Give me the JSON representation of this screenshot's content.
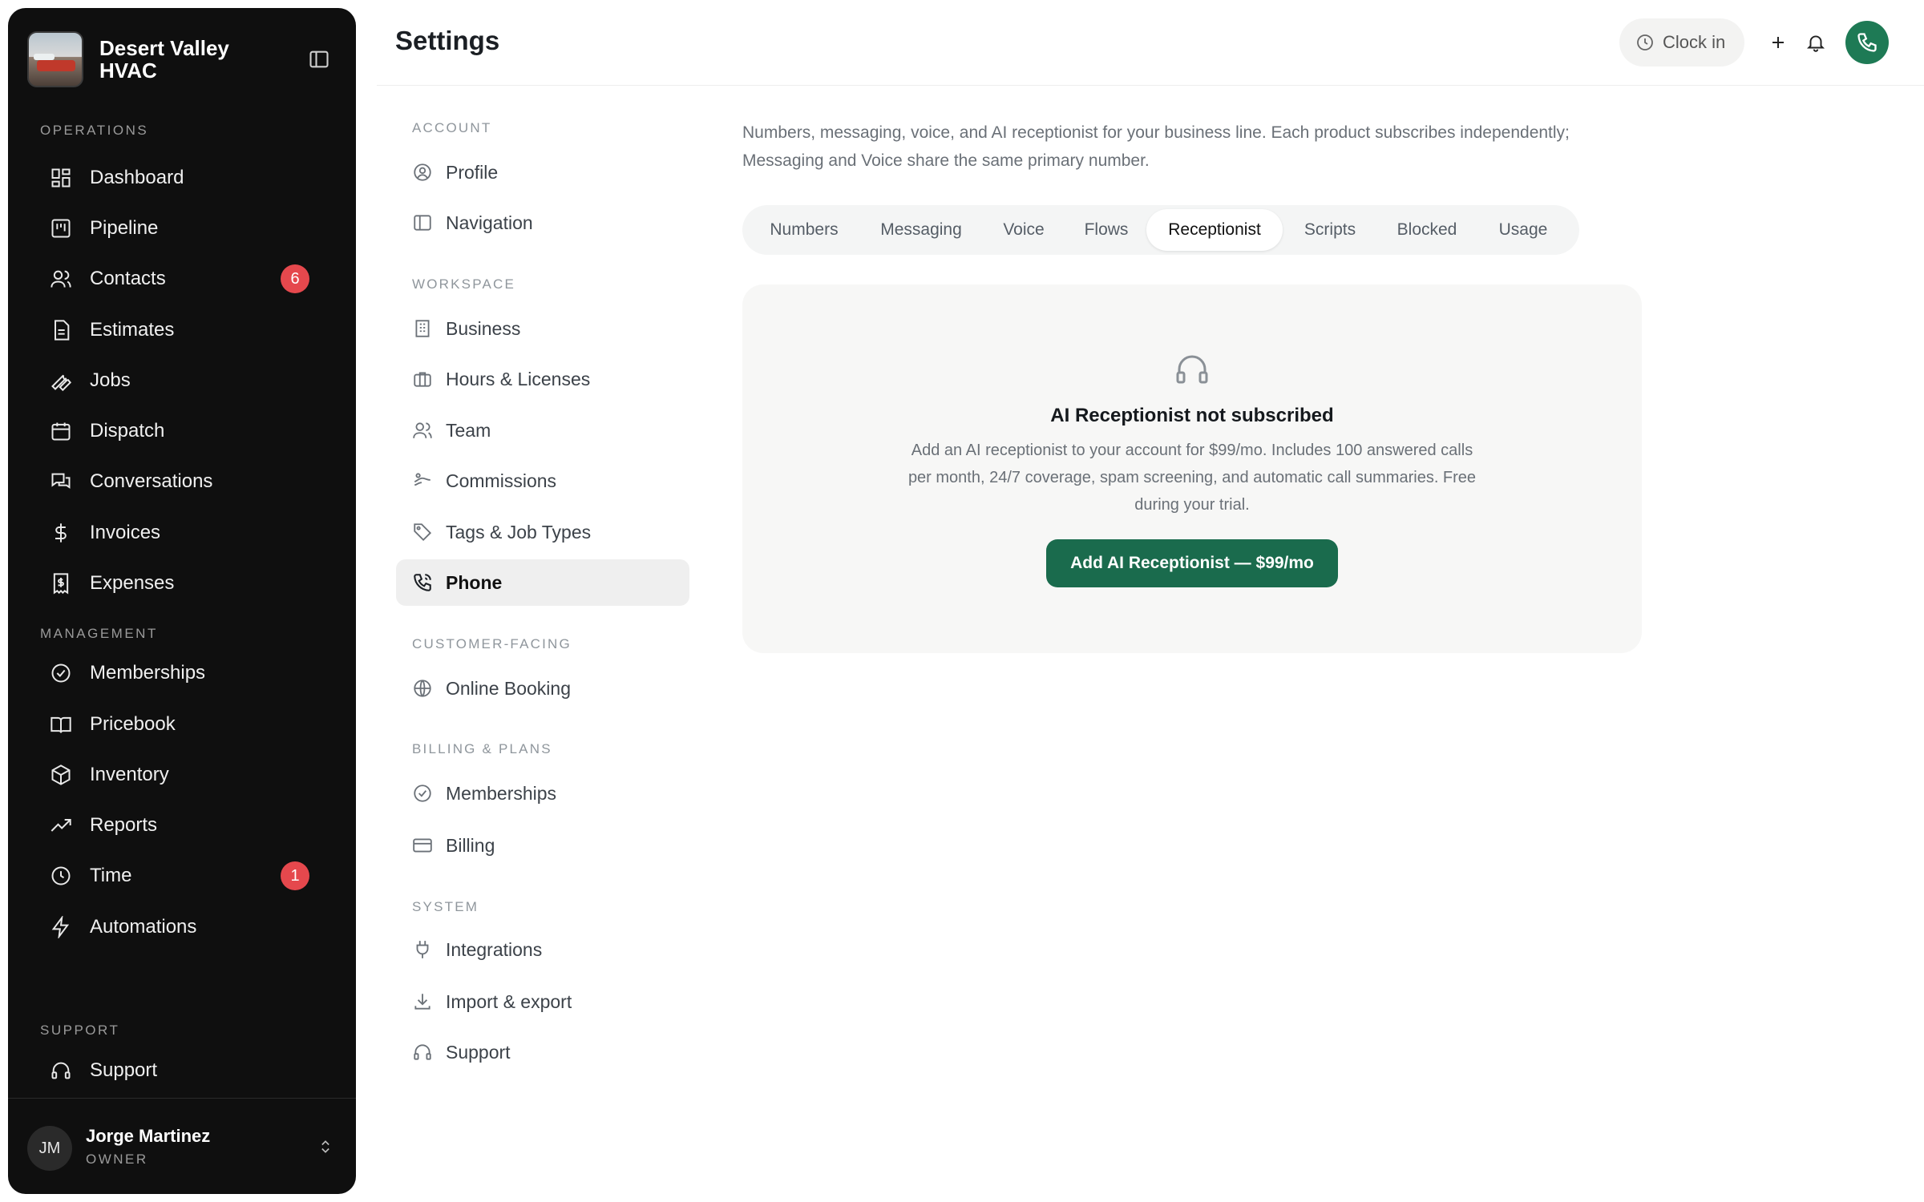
{
  "brand": {
    "name": "Desert Valley HVAC"
  },
  "sidebar": {
    "sections": [
      {
        "label": "OPERATIONS",
        "items": [
          {
            "label": "Dashboard",
            "icon": "grid-icon"
          },
          {
            "label": "Pipeline",
            "icon": "kanban-icon"
          },
          {
            "label": "Contacts",
            "icon": "users-icon",
            "badge": "6"
          },
          {
            "label": "Estimates",
            "icon": "document-icon"
          },
          {
            "label": "Jobs",
            "icon": "wrench-icon"
          },
          {
            "label": "Dispatch",
            "icon": "calendar-icon"
          },
          {
            "label": "Conversations",
            "icon": "chat-icon"
          },
          {
            "label": "Invoices",
            "icon": "dollar-icon"
          },
          {
            "label": "Expenses",
            "icon": "receipt-icon"
          }
        ]
      },
      {
        "label": "MANAGEMENT",
        "items": [
          {
            "label": "Memberships",
            "icon": "check-circle-icon"
          },
          {
            "label": "Pricebook",
            "icon": "book-icon"
          },
          {
            "label": "Inventory",
            "icon": "box-icon"
          },
          {
            "label": "Reports",
            "icon": "trend-icon"
          },
          {
            "label": "Time",
            "icon": "clock-icon",
            "badge": "1"
          },
          {
            "label": "Automations",
            "icon": "bolt-icon"
          }
        ]
      },
      {
        "label": "SUPPORT",
        "items": [
          {
            "label": "Support",
            "icon": "headset-icon"
          }
        ]
      }
    ],
    "user": {
      "initials": "JM",
      "name": "Jorge Martinez",
      "role": "OWNER"
    }
  },
  "header": {
    "title": "Settings",
    "clock_label": "Clock in"
  },
  "settings_nav": {
    "sections": [
      {
        "label": "ACCOUNT",
        "items": [
          {
            "label": "Profile",
            "icon": "user-circle-icon"
          },
          {
            "label": "Navigation",
            "icon": "sidebar-icon"
          }
        ]
      },
      {
        "label": "WORKSPACE",
        "items": [
          {
            "label": "Business",
            "icon": "building-icon"
          },
          {
            "label": "Hours & Licenses",
            "icon": "briefcase-icon"
          },
          {
            "label": "Team",
            "icon": "users-icon"
          },
          {
            "label": "Commissions",
            "icon": "percent-icon"
          },
          {
            "label": "Tags & Job Types",
            "icon": "tag-icon"
          },
          {
            "label": "Phone",
            "icon": "phone-icon",
            "active": true
          }
        ]
      },
      {
        "label": "CUSTOMER-FACING",
        "items": [
          {
            "label": "Online Booking",
            "icon": "globe-icon"
          }
        ]
      },
      {
        "label": "BILLING & PLANS",
        "items": [
          {
            "label": "Memberships",
            "icon": "check-circle-icon"
          },
          {
            "label": "Billing",
            "icon": "credit-card-icon"
          }
        ]
      },
      {
        "label": "SYSTEM",
        "items": [
          {
            "label": "Integrations",
            "icon": "plug-icon"
          },
          {
            "label": "Import & export",
            "icon": "download-icon"
          },
          {
            "label": "Support",
            "icon": "headset-icon"
          }
        ]
      }
    ]
  },
  "content": {
    "description": "Numbers, messaging, voice, and AI receptionist for your business line. Each product subscribes independently; Messaging and Voice share the same primary number.",
    "tabs": [
      {
        "label": "Numbers"
      },
      {
        "label": "Messaging"
      },
      {
        "label": "Voice"
      },
      {
        "label": "Flows"
      },
      {
        "label": "Receptionist",
        "active": true
      },
      {
        "label": "Scripts"
      },
      {
        "label": "Blocked"
      },
      {
        "label": "Usage"
      }
    ],
    "card": {
      "title": "AI Receptionist not subscribed",
      "body": "Add an AI receptionist to your account for $99/mo. Includes 100 answered calls per month, 24/7 coverage, spam screening, and automatic call summaries. Free during your trial.",
      "cta": "Add AI Receptionist — $99/mo"
    }
  },
  "colors": {
    "accent": "#1a6b4d",
    "badge": "#e5484d",
    "sidebar_bg": "#0f0f0f"
  }
}
